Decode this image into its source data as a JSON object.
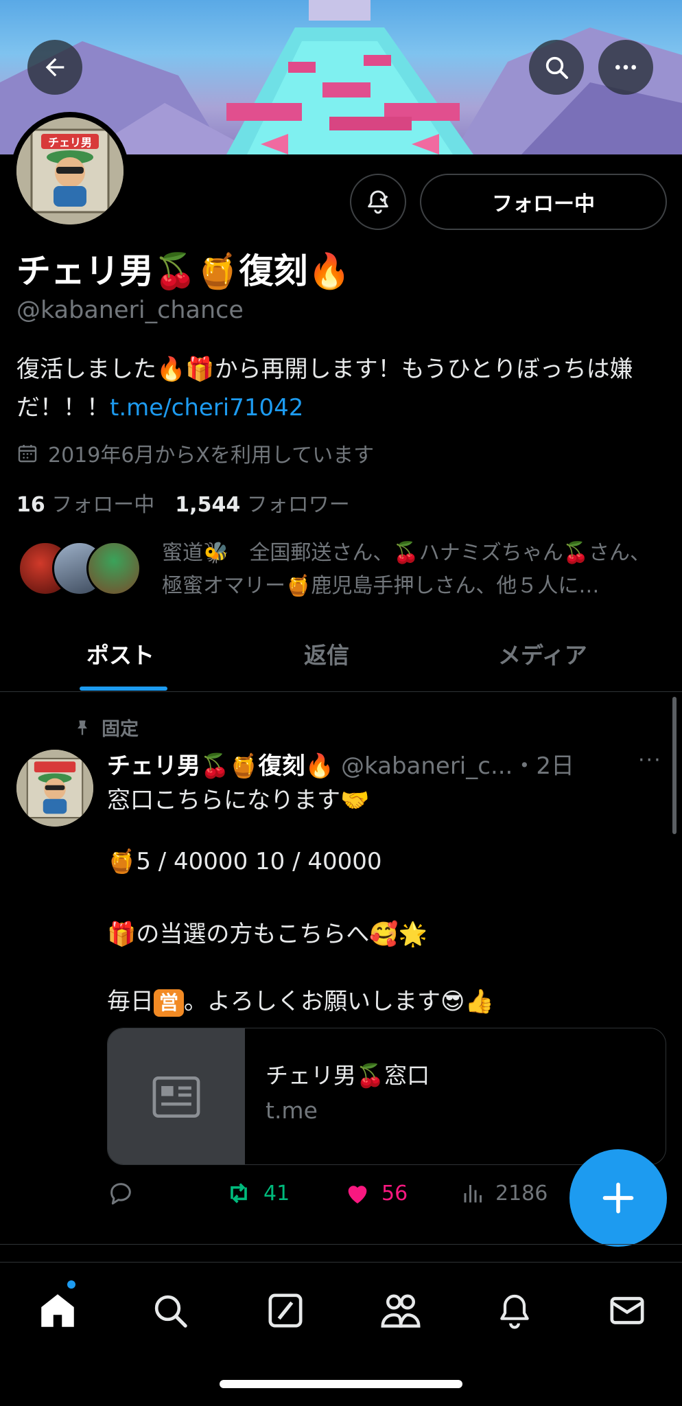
{
  "header": {
    "back_icon": "arrow-left-icon",
    "search_icon": "search-icon",
    "more_icon": "more-horizontal-icon"
  },
  "profile": {
    "display_name": "チェリ男🍒🍯復刻🔥",
    "handle": "@kabaneri_chance",
    "follow_label": "フォロー中",
    "bio_text": "復活しました🔥🎁から再開します！もうひとりぼっちは嫌だ！！！",
    "bio_link": "t.me/cheri71042",
    "joined": "2019年6月からXを利用しています",
    "following_count": "16",
    "following_label": "フォロー中",
    "followers_count": "1,544",
    "followers_label": "フォロワー",
    "mutuals_text": "蜜道🐝　全国郵送さん、🍒ハナミズちゃん🍒さん、極蜜オマリー🍯鹿児島手押しさん、他５人に…",
    "avatar_label": "チェリ男"
  },
  "tabs": [
    {
      "label": "ポスト"
    },
    {
      "label": "返信"
    },
    {
      "label": "メディア"
    }
  ],
  "post": {
    "pinned_label": "固定",
    "author_name": "チェリ男🍒🍯復刻🔥",
    "author_handle_time": "@kabaneri_c...・2日",
    "more": "···",
    "line1": "窓口こちらになります🤝",
    "line2": "🍯5 / 40000  10 / 40000",
    "line3": "🎁の当選の方もこちらへ🥰🌟",
    "line4_pre": "毎日",
    "line4_badge": "営",
    "line4_post": "。よろしくお願いします😎👍",
    "card_title": "チェリ男🍒窓口",
    "card_domain": "t.me",
    "retweets": "41",
    "likes": "56",
    "views": "2186"
  },
  "colors": {
    "accent": "#1d9bf0",
    "retweet": "#00ba7c",
    "like": "#f91880",
    "muted": "#71767b"
  }
}
